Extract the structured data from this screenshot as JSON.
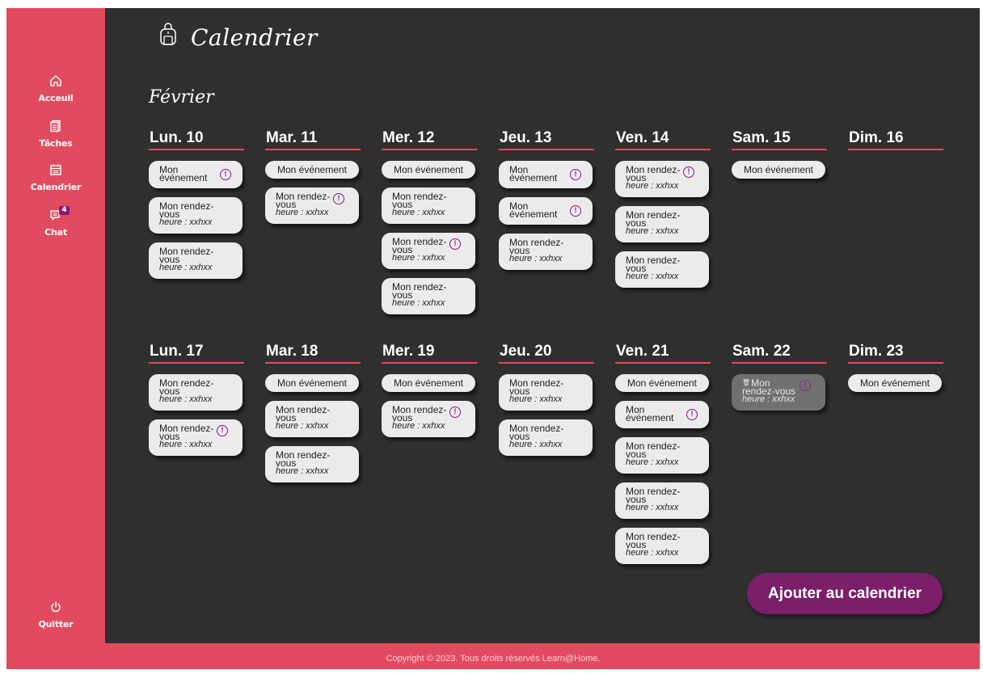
{
  "app": {
    "title": "Calendrier",
    "month": "Février"
  },
  "sidebar": {
    "items": [
      {
        "label": "Acceuil",
        "icon": "home-icon"
      },
      {
        "label": "Tâches",
        "icon": "tasks-icon"
      },
      {
        "label": "Calendrier",
        "icon": "calendar-icon"
      },
      {
        "label": "Chat",
        "icon": "chat-icon",
        "badge": "4"
      }
    ],
    "quit": {
      "label": "Quitter",
      "icon": "power-icon"
    }
  },
  "weeks": [
    [
      {
        "day": "Lun. 10",
        "items": [
          {
            "kind": "event",
            "label": "Mon événement",
            "alert": true
          },
          {
            "kind": "appt",
            "label": "Mon rendez-vous",
            "time": "heure : xxhxx",
            "alert": false
          },
          {
            "kind": "appt",
            "label": "Mon rendez-vous",
            "time": "heure : xxhxx",
            "alert": false
          }
        ]
      },
      {
        "day": "Mar. 11",
        "items": [
          {
            "kind": "event",
            "label": "Mon événement",
            "alert": false
          },
          {
            "kind": "appt",
            "label": "Mon rendez-vous",
            "time": "heure : xxhxx",
            "alert": true
          }
        ]
      },
      {
        "day": "Mer. 12",
        "items": [
          {
            "kind": "event",
            "label": "Mon événement",
            "alert": false
          },
          {
            "kind": "appt",
            "label": "Mon rendez-vous",
            "time": "heure : xxhxx",
            "alert": false
          },
          {
            "kind": "appt",
            "label": "Mon rendez-vous",
            "time": "heure : xxhxx",
            "alert": true
          },
          {
            "kind": "appt",
            "label": "Mon rendez-vous",
            "time": "heure : xxhxx",
            "alert": false
          }
        ]
      },
      {
        "day": "Jeu. 13",
        "items": [
          {
            "kind": "event",
            "label": "Mon événement",
            "alert": true
          },
          {
            "kind": "event",
            "label": "Mon événement",
            "alert": true
          },
          {
            "kind": "appt",
            "label": "Mon rendez-vous",
            "time": "heure : xxhxx",
            "alert": false
          }
        ]
      },
      {
        "day": "Ven. 14",
        "items": [
          {
            "kind": "appt",
            "label": "Mon rendez-vous",
            "time": "heure : xxhxx",
            "alert": true
          },
          {
            "kind": "appt",
            "label": "Mon rendez-vous",
            "time": "heure : xxhxx",
            "alert": false
          },
          {
            "kind": "appt",
            "label": "Mon rendez-vous",
            "time": "heure : xxhxx",
            "alert": false
          }
        ]
      },
      {
        "day": "Sam. 15",
        "items": [
          {
            "kind": "event",
            "label": "Mon événement",
            "alert": false
          }
        ]
      },
      {
        "day": "Dim. 16",
        "items": []
      }
    ],
    [
      {
        "day": "Lun. 17",
        "items": [
          {
            "kind": "appt",
            "label": "Mon rendez-vous",
            "time": "heure : xxhxx",
            "alert": false
          },
          {
            "kind": "appt",
            "label": "Mon rendez-vous",
            "time": "heure : xxhxx",
            "alert": true
          }
        ]
      },
      {
        "day": "Mar. 18",
        "items": [
          {
            "kind": "event",
            "label": "Mon événement",
            "alert": false
          },
          {
            "kind": "appt",
            "label": "Mon rendez-vous",
            "time": "heure : xxhxx",
            "alert": false
          },
          {
            "kind": "appt",
            "label": "Mon rendez-vous",
            "time": "heure : xxhxx",
            "alert": false
          }
        ]
      },
      {
        "day": "Mer. 19",
        "items": [
          {
            "kind": "event",
            "label": "Mon événement",
            "alert": false
          },
          {
            "kind": "appt",
            "label": "Mon rendez-vous",
            "time": "heure : xxhxx",
            "alert": true
          }
        ]
      },
      {
        "day": "Jeu. 20",
        "items": [
          {
            "kind": "appt",
            "label": "Mon rendez-vous",
            "time": "heure : xxhxx",
            "alert": false
          },
          {
            "kind": "appt",
            "label": "Mon rendez-vous",
            "time": "heure : xxhxx",
            "alert": false
          }
        ]
      },
      {
        "day": "Ven. 21",
        "items": [
          {
            "kind": "event",
            "label": "Mon événement",
            "alert": false
          },
          {
            "kind": "event",
            "label": "Mon événement",
            "alert": true
          },
          {
            "kind": "appt",
            "label": "Mon rendez-vous",
            "time": "heure : xxhxx",
            "alert": false
          },
          {
            "kind": "appt",
            "label": "Mon rendez-vous",
            "time": "heure : xxhxx",
            "alert": false
          },
          {
            "kind": "appt",
            "label": "Mon rendez-vous",
            "time": "heure : xxhxx",
            "alert": false
          }
        ]
      },
      {
        "day": "Sam. 22",
        "items": [
          {
            "kind": "appt",
            "label": "Mon rendez-vous",
            "time": "heure : xxhxx",
            "alert": true,
            "dimmed": true,
            "trash": true
          }
        ]
      },
      {
        "day": "Dim. 23",
        "items": [
          {
            "kind": "event",
            "label": "Mon événement",
            "alert": false
          }
        ]
      }
    ]
  ],
  "actions": {
    "add_label": "Ajouter au calendrier"
  },
  "footer": {
    "text": "Copyright © 2023. Tous droits réservés Learn@Home."
  },
  "colors": {
    "accent": "#e24b5f",
    "background": "#2f2f2f",
    "button": "#7b1f6a",
    "chip": "#ebebeb",
    "alert": "#7b1f7a"
  }
}
